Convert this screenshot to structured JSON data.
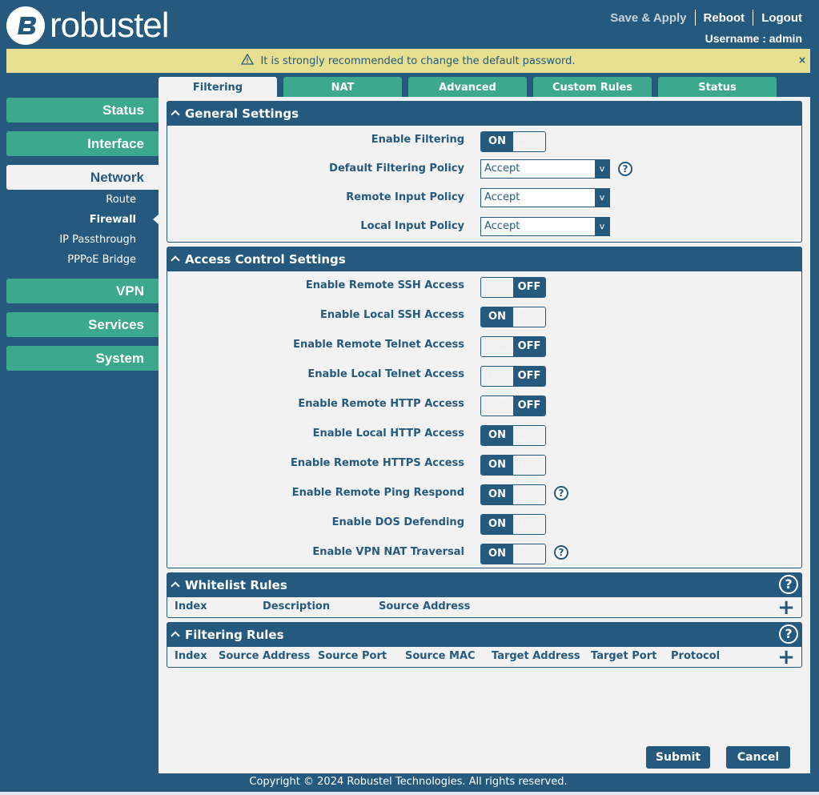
{
  "brand": {
    "name": "robustel"
  },
  "header": {
    "save_apply": "Save & Apply",
    "reboot": "Reboot",
    "logout": "Logout",
    "username": "Username : admin"
  },
  "warning": {
    "text": "It is strongly recommended to change the default password.",
    "close": "×"
  },
  "sidebar": {
    "status": "Status",
    "interface": "Interface",
    "network": "Network",
    "sub": {
      "route": "Route",
      "firewall": "Firewall",
      "ip_passthrough": "IP Passthrough",
      "pppoe": "PPPoE Bridge"
    },
    "vpn": "VPN",
    "services": "Services",
    "system": "System"
  },
  "tabs": [
    "Filtering",
    "NAT",
    "Advanced",
    "Custom Rules",
    "Status"
  ],
  "general": {
    "title": "General Settings",
    "enable_filtering": {
      "label": "Enable Filtering",
      "on": "ON",
      "off": "OFF",
      "state": "on"
    },
    "default_policy": {
      "label": "Default Filtering Policy",
      "value": "Accept"
    },
    "remote_input": {
      "label": "Remote Input Policy",
      "value": "Accept"
    },
    "local_input": {
      "label": "Local Input Policy",
      "value": "Accept"
    },
    "help": "?",
    "dd": "v"
  },
  "access": {
    "title": "Access Control Settings",
    "on": "ON",
    "off": "OFF",
    "rows": [
      {
        "label": "Enable Remote SSH Access",
        "state": "off"
      },
      {
        "label": "Enable Local SSH Access",
        "state": "on"
      },
      {
        "label": "Enable Remote Telnet Access",
        "state": "off"
      },
      {
        "label": "Enable Local Telnet Access",
        "state": "off"
      },
      {
        "label": "Enable Remote HTTP Access",
        "state": "off"
      },
      {
        "label": "Enable Local HTTP Access",
        "state": "on"
      },
      {
        "label": "Enable Remote HTTPS Access",
        "state": "on"
      },
      {
        "label": "Enable Remote Ping Respond",
        "state": "on"
      },
      {
        "label": "Enable DOS Defending",
        "state": "on"
      },
      {
        "label": "Enable VPN NAT Traversal",
        "state": "on"
      }
    ]
  },
  "whitelist": {
    "title": "Whitelist Rules",
    "cols": [
      "Index",
      "Description",
      "Source Address"
    ],
    "add": "+"
  },
  "filtering_rules": {
    "title": "Filtering Rules",
    "cols": [
      "Index",
      "Source Address",
      "Source Port",
      "Source MAC",
      "Target Address",
      "Target Port",
      "Protocol"
    ],
    "add": "+"
  },
  "buttons": {
    "submit": "Submit",
    "cancel": "Cancel"
  },
  "footer": "Copyright © 2024 Robustel Technologies. All rights reserved.",
  "colors": {
    "primary": "#255a7e",
    "accent": "#3ca88e",
    "warning_bg": "#e5df8f",
    "panel": "#f2f2f2"
  }
}
